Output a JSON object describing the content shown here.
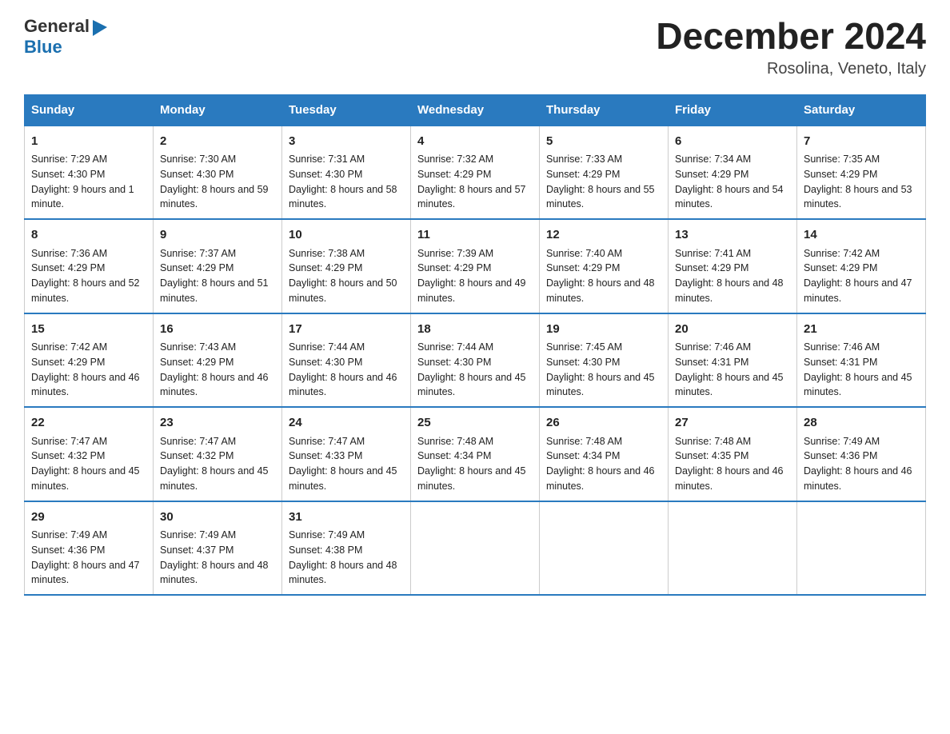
{
  "header": {
    "logo": {
      "text_general": "General",
      "text_blue": "Blue",
      "triangle": "▶"
    },
    "title": "December 2024",
    "location": "Rosolina, Veneto, Italy"
  },
  "days_of_week": [
    "Sunday",
    "Monday",
    "Tuesday",
    "Wednesday",
    "Thursday",
    "Friday",
    "Saturday"
  ],
  "weeks": [
    [
      {
        "day": "1",
        "sunrise": "7:29 AM",
        "sunset": "4:30 PM",
        "daylight": "9 hours and 1 minute."
      },
      {
        "day": "2",
        "sunrise": "7:30 AM",
        "sunset": "4:30 PM",
        "daylight": "8 hours and 59 minutes."
      },
      {
        "day": "3",
        "sunrise": "7:31 AM",
        "sunset": "4:30 PM",
        "daylight": "8 hours and 58 minutes."
      },
      {
        "day": "4",
        "sunrise": "7:32 AM",
        "sunset": "4:29 PM",
        "daylight": "8 hours and 57 minutes."
      },
      {
        "day": "5",
        "sunrise": "7:33 AM",
        "sunset": "4:29 PM",
        "daylight": "8 hours and 55 minutes."
      },
      {
        "day": "6",
        "sunrise": "7:34 AM",
        "sunset": "4:29 PM",
        "daylight": "8 hours and 54 minutes."
      },
      {
        "day": "7",
        "sunrise": "7:35 AM",
        "sunset": "4:29 PM",
        "daylight": "8 hours and 53 minutes."
      }
    ],
    [
      {
        "day": "8",
        "sunrise": "7:36 AM",
        "sunset": "4:29 PM",
        "daylight": "8 hours and 52 minutes."
      },
      {
        "day": "9",
        "sunrise": "7:37 AM",
        "sunset": "4:29 PM",
        "daylight": "8 hours and 51 minutes."
      },
      {
        "day": "10",
        "sunrise": "7:38 AM",
        "sunset": "4:29 PM",
        "daylight": "8 hours and 50 minutes."
      },
      {
        "day": "11",
        "sunrise": "7:39 AM",
        "sunset": "4:29 PM",
        "daylight": "8 hours and 49 minutes."
      },
      {
        "day": "12",
        "sunrise": "7:40 AM",
        "sunset": "4:29 PM",
        "daylight": "8 hours and 48 minutes."
      },
      {
        "day": "13",
        "sunrise": "7:41 AM",
        "sunset": "4:29 PM",
        "daylight": "8 hours and 48 minutes."
      },
      {
        "day": "14",
        "sunrise": "7:42 AM",
        "sunset": "4:29 PM",
        "daylight": "8 hours and 47 minutes."
      }
    ],
    [
      {
        "day": "15",
        "sunrise": "7:42 AM",
        "sunset": "4:29 PM",
        "daylight": "8 hours and 46 minutes."
      },
      {
        "day": "16",
        "sunrise": "7:43 AM",
        "sunset": "4:29 PM",
        "daylight": "8 hours and 46 minutes."
      },
      {
        "day": "17",
        "sunrise": "7:44 AM",
        "sunset": "4:30 PM",
        "daylight": "8 hours and 46 minutes."
      },
      {
        "day": "18",
        "sunrise": "7:44 AM",
        "sunset": "4:30 PM",
        "daylight": "8 hours and 45 minutes."
      },
      {
        "day": "19",
        "sunrise": "7:45 AM",
        "sunset": "4:30 PM",
        "daylight": "8 hours and 45 minutes."
      },
      {
        "day": "20",
        "sunrise": "7:46 AM",
        "sunset": "4:31 PM",
        "daylight": "8 hours and 45 minutes."
      },
      {
        "day": "21",
        "sunrise": "7:46 AM",
        "sunset": "4:31 PM",
        "daylight": "8 hours and 45 minutes."
      }
    ],
    [
      {
        "day": "22",
        "sunrise": "7:47 AM",
        "sunset": "4:32 PM",
        "daylight": "8 hours and 45 minutes."
      },
      {
        "day": "23",
        "sunrise": "7:47 AM",
        "sunset": "4:32 PM",
        "daylight": "8 hours and 45 minutes."
      },
      {
        "day": "24",
        "sunrise": "7:47 AM",
        "sunset": "4:33 PM",
        "daylight": "8 hours and 45 minutes."
      },
      {
        "day": "25",
        "sunrise": "7:48 AM",
        "sunset": "4:34 PM",
        "daylight": "8 hours and 45 minutes."
      },
      {
        "day": "26",
        "sunrise": "7:48 AM",
        "sunset": "4:34 PM",
        "daylight": "8 hours and 46 minutes."
      },
      {
        "day": "27",
        "sunrise": "7:48 AM",
        "sunset": "4:35 PM",
        "daylight": "8 hours and 46 minutes."
      },
      {
        "day": "28",
        "sunrise": "7:49 AM",
        "sunset": "4:36 PM",
        "daylight": "8 hours and 46 minutes."
      }
    ],
    [
      {
        "day": "29",
        "sunrise": "7:49 AM",
        "sunset": "4:36 PM",
        "daylight": "8 hours and 47 minutes."
      },
      {
        "day": "30",
        "sunrise": "7:49 AM",
        "sunset": "4:37 PM",
        "daylight": "8 hours and 48 minutes."
      },
      {
        "day": "31",
        "sunrise": "7:49 AM",
        "sunset": "4:38 PM",
        "daylight": "8 hours and 48 minutes."
      },
      null,
      null,
      null,
      null
    ]
  ]
}
